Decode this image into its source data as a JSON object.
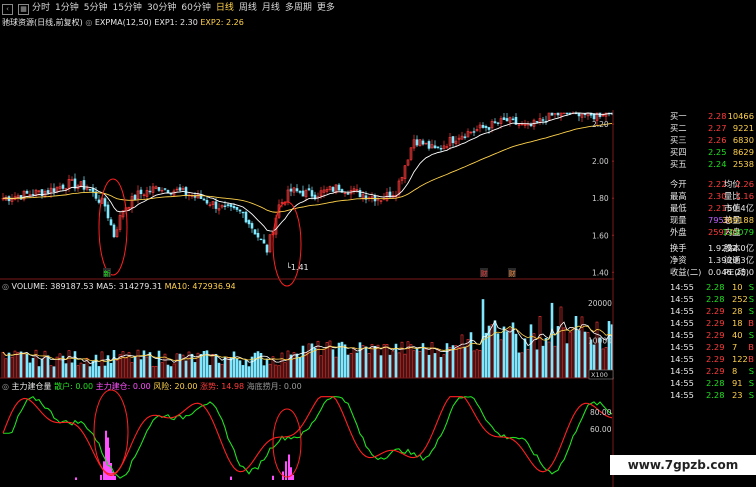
{
  "toolbar": {
    "items": [
      {
        "label": "分时",
        "active": false
      },
      {
        "label": "1分钟",
        "active": false
      },
      {
        "label": "5分钟",
        "active": false
      },
      {
        "label": "15分钟",
        "active": false
      },
      {
        "label": "30分钟",
        "active": false
      },
      {
        "label": "60分钟",
        "active": false
      },
      {
        "label": "日线",
        "active": true
      },
      {
        "label": "周线",
        "active": false
      },
      {
        "label": "月线",
        "active": false
      },
      {
        "label": "多周期",
        "active": false
      },
      {
        "label": "更多",
        "active": false
      }
    ]
  },
  "main_chart": {
    "title": "驰球资源(日线,前复权)",
    "indicator": "EXPMA(12,50)",
    "exp1_label": "EXP1: 2.30",
    "exp2_label": "EXP2: 2.26",
    "low_marker": "1.41",
    "price_ticks": [
      "2.20",
      "2.00",
      "1.80",
      "1.60",
      "1.40"
    ],
    "badges": [
      "新",
      "财",
      "财"
    ]
  },
  "volume_chart": {
    "label": "VOLUME: 389187.53",
    "ma5_label": "MA5: 314279.31",
    "ma10_label": "MA10: 472936.94",
    "ticks": [
      "20000",
      "10000"
    ],
    "unit": "X100"
  },
  "capital_chart": {
    "title": "主力建仓量",
    "retail_label": "散户: 0.00",
    "main_label": "主力建仓: 0.00",
    "risk_label": "风险: 20.00",
    "rise_label": "涨势: 14.98",
    "extra_label": "海底捞月: 0.00",
    "ticks": [
      "80.00",
      "60.00"
    ]
  },
  "quote_panel": {
    "bids": [
      {
        "label": "买一",
        "price": "2.28",
        "vol": "10466"
      },
      {
        "label": "买二",
        "price": "2.27",
        "vol": "9221"
      },
      {
        "label": "买三",
        "price": "2.26",
        "vol": "6830"
      },
      {
        "label": "买四",
        "price": "2.25",
        "vol": "8629"
      },
      {
        "label": "买五",
        "price": "2.24",
        "vol": "2538"
      }
    ],
    "stats": [
      {
        "l1": "今开",
        "v1": "2.22",
        "l2": "均价",
        "v2": "2.26"
      },
      {
        "l1": "最高",
        "v1": "2.30",
        "l2": "量比",
        "v2": "1.16"
      },
      {
        "l1": "最低",
        "v1": "2.21",
        "l2": "市值",
        "v2": "50.4亿"
      },
      {
        "l1": "现量",
        "v1": "7953",
        "l2": "总量",
        "v2": "389188"
      },
      {
        "l1": "外盘",
        "v1": "259109",
        "l2": "内盘",
        "v2": "130079"
      }
    ],
    "stats2": [
      {
        "l1": "换手",
        "v1": "1.92%",
        "l2": "股本",
        "v2": "22.0亿"
      },
      {
        "l1": "净资",
        "v1": "1.39",
        "l2": "流通",
        "v2": "20.3亿"
      },
      {
        "l1": "收益(二)",
        "v1": "0.046",
        "l2": "PE(动)",
        "v2": "25.0"
      }
    ],
    "trades": [
      {
        "time": "14:55",
        "price": "2.28",
        "vol": "10",
        "side": "S"
      },
      {
        "time": "14:55",
        "price": "2.28",
        "vol": "252",
        "side": "S"
      },
      {
        "time": "14:55",
        "price": "2.29",
        "vol": "28",
        "side": "S"
      },
      {
        "time": "14:55",
        "price": "2.29",
        "vol": "18",
        "side": "B"
      },
      {
        "time": "14:55",
        "price": "2.29",
        "vol": "40",
        "side": "S"
      },
      {
        "time": "14:55",
        "price": "2.29",
        "vol": "7",
        "side": "B"
      },
      {
        "time": "14:55",
        "price": "2.29",
        "vol": "122",
        "side": "B"
      },
      {
        "time": "14:55",
        "price": "2.29",
        "vol": "8",
        "side": "S"
      },
      {
        "time": "14:55",
        "price": "2.28",
        "vol": "91",
        "side": "S"
      },
      {
        "time": "14:55",
        "price": "2.28",
        "vol": "23",
        "side": "S"
      }
    ]
  },
  "watermark": "www.7gpzb.com",
  "colors": {
    "up": "#ff3b3b",
    "down": "#7fe8ff",
    "exp1": "#ffffff",
    "exp2": "#ffd24a",
    "accent": "#ffd24a"
  }
}
